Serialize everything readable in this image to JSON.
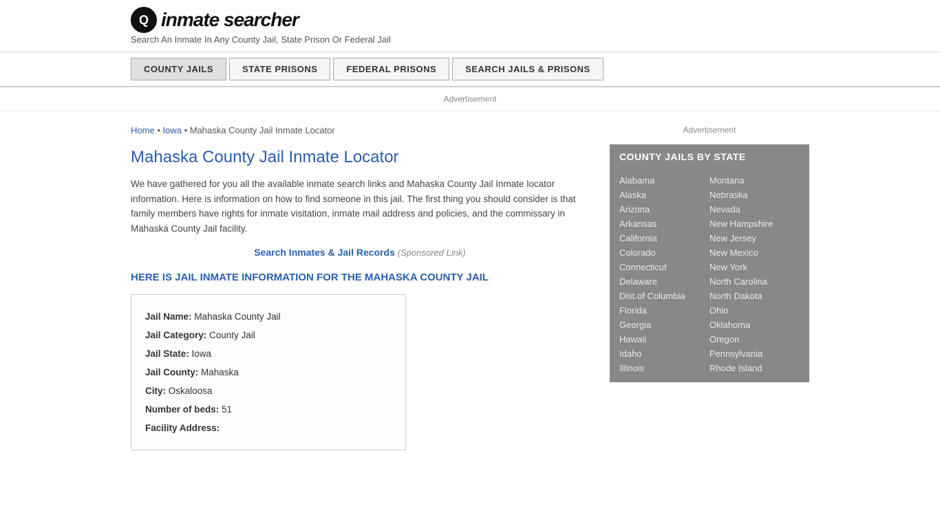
{
  "header": {
    "logo_symbol": "Q",
    "logo_text": "inmate searcher",
    "tagline": "Search An Inmate In Any County Jail, State Prison Or Federal Jail"
  },
  "nav": {
    "items": [
      {
        "label": "COUNTY JAILS",
        "active": true
      },
      {
        "label": "STATE PRISONS",
        "active": false
      },
      {
        "label": "FEDERAL PRISONS",
        "active": false
      },
      {
        "label": "SEARCH JAILS & PRISONS",
        "active": false
      }
    ]
  },
  "ad_label": "Advertisement",
  "breadcrumb": {
    "home": "Home",
    "state": "Iowa",
    "current": "Mahaska County Jail Inmate Locator"
  },
  "page_title": "Mahaska County Jail Inmate Locator",
  "description": "We have gathered for you all the available inmate search links and Mahaska County Jail Inmate locator information. Here is information on how to find someone in this jail. The first thing you should consider is that family members have rights for inmate visitation, inmate mail address and policies, and the commissary in Mahaska County Jail facility.",
  "sponsored": {
    "link_text": "Search Inmates & Jail Records",
    "label": "(Sponsored Link)"
  },
  "section_heading": "HERE IS JAIL INMATE INFORMATION FOR THE MAHASKA COUNTY JAIL",
  "info": {
    "jail_name_label": "Jail Name:",
    "jail_name_value": "Mahaska County Jail",
    "jail_category_label": "Jail Category:",
    "jail_category_value": "County Jail",
    "jail_state_label": "Jail State:",
    "jail_state_value": "Iowa",
    "jail_county_label": "Jail County:",
    "jail_county_value": "Mahaska",
    "city_label": "City:",
    "city_value": "Oskaloosa",
    "beds_label": "Number of beds:",
    "beds_value": "51",
    "facility_label": "Facility Address:"
  },
  "sidebar": {
    "ad_label": "Advertisement",
    "state_box_title": "COUNTY JAILS BY STATE",
    "states_col1": [
      "Alabama",
      "Alaska",
      "Arizona",
      "Arkansas",
      "California",
      "Colorado",
      "Connecticut",
      "Delaware",
      "Dist.of Columbia",
      "Florida",
      "Georgia",
      "Hawaii",
      "Idaho",
      "Illinois"
    ],
    "states_col2": [
      "Montana",
      "Nebraska",
      "Nevada",
      "New Hampshire",
      "New Jersey",
      "New Mexico",
      "New York",
      "North Carolina",
      "North Dakota",
      "Ohio",
      "Oklahoma",
      "Oregon",
      "Pennsylvania",
      "Rhode Island"
    ]
  }
}
